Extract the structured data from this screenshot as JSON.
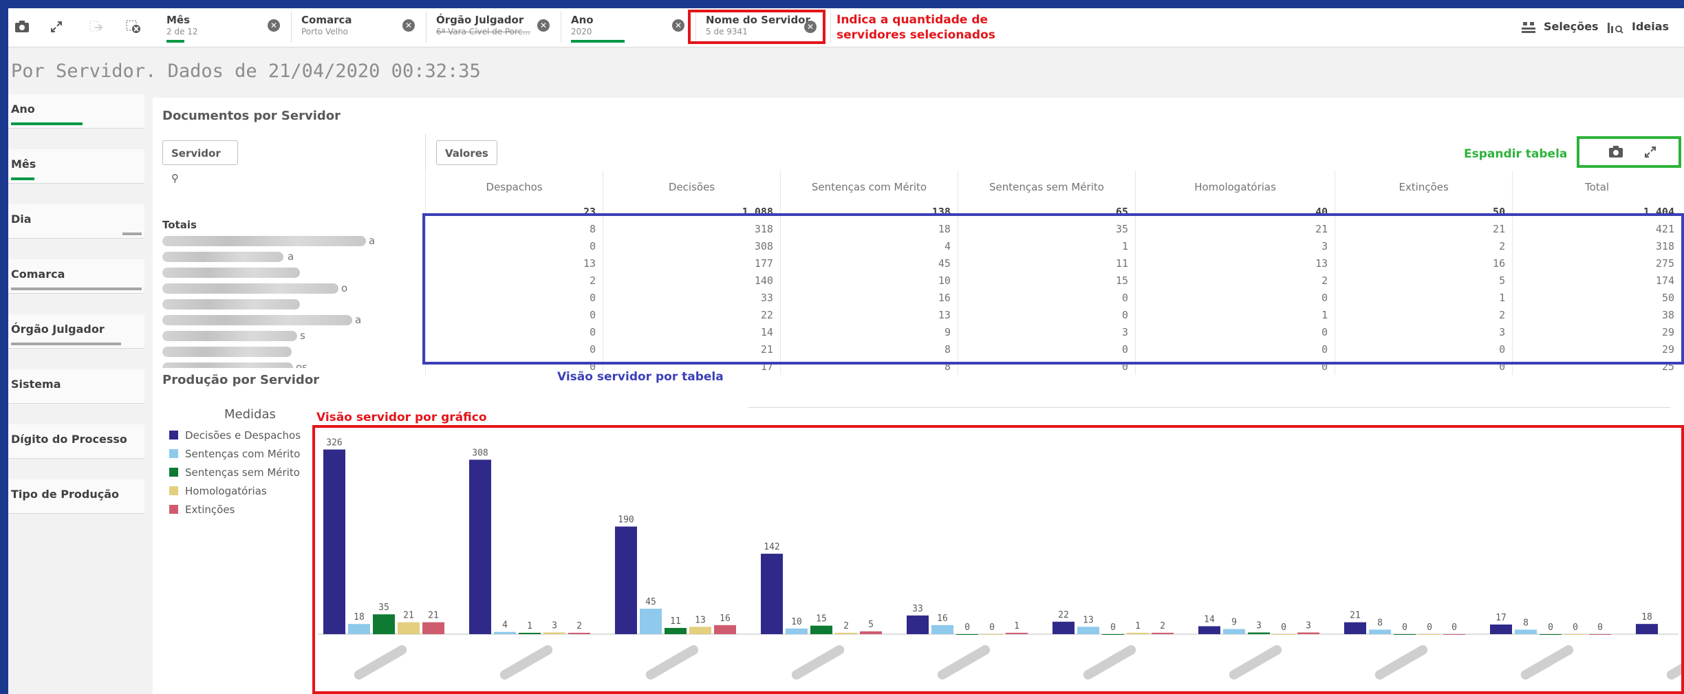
{
  "topbar": {
    "chips": [
      {
        "title": "Mês",
        "sub": "2 de 12"
      },
      {
        "title": "Comarca",
        "sub": "Porto Velho"
      },
      {
        "title": "Órgão Julgador",
        "sub": "6ª Vara Cível de Porc..."
      },
      {
        "title": "Ano",
        "sub": "2020"
      },
      {
        "title": "Nome do Servidor",
        "sub": "5 de 9341"
      }
    ],
    "selections_label": "Seleções",
    "ideas_label": "Ideias"
  },
  "annotations": {
    "servers_line1": "Indica a quantidade de",
    "servers_line2": "servidores selecionados",
    "expand_table": "Espandir tabela",
    "table_view": "Visão servidor por tabela",
    "chart_view": "Visão servidor por gráfico"
  },
  "page_title": "Por Servidor. Dados de 21/04/2020 00:32:35",
  "filters": [
    "Ano",
    "Mês",
    "Dia",
    "Comarca",
    "Órgão Julgador",
    "Sistema",
    "Dígito do Processo",
    "Tipo de Produção"
  ],
  "table": {
    "title": "Documentos por Servidor",
    "search_label": "Servidor",
    "values_label": "Valores",
    "columns": [
      "Despachos",
      "Decisões",
      "Sentenças com Mérito",
      "Sentenças sem Mérito",
      "Homologatórias",
      "Extinções",
      "Total"
    ],
    "totals_label": "Totais",
    "name_suffixes": [
      "a",
      "a",
      "",
      "o",
      "",
      "a",
      "s",
      "",
      "os"
    ],
    "rows": [
      [
        "23",
        "1.088",
        "138",
        "65",
        "40",
        "50",
        "1.404"
      ],
      [
        "8",
        "318",
        "18",
        "35",
        "21",
        "21",
        "421"
      ],
      [
        "0",
        "308",
        "4",
        "1",
        "3",
        "2",
        "318"
      ],
      [
        "13",
        "177",
        "45",
        "11",
        "13",
        "16",
        "275"
      ],
      [
        "2",
        "140",
        "10",
        "15",
        "2",
        "5",
        "174"
      ],
      [
        "0",
        "33",
        "16",
        "0",
        "0",
        "1",
        "50"
      ],
      [
        "0",
        "22",
        "13",
        "0",
        "1",
        "2",
        "38"
      ],
      [
        "0",
        "14",
        "9",
        "3",
        "0",
        "3",
        "29"
      ],
      [
        "0",
        "21",
        "8",
        "0",
        "0",
        "0",
        "29"
      ],
      [
        "0",
        "17",
        "8",
        "0",
        "0",
        "0",
        "25"
      ]
    ]
  },
  "chart": {
    "title": "Produção por Servidor",
    "legend_title": "Medidas"
  },
  "chart_data": {
    "type": "bar",
    "title": "Produção por Servidor",
    "categories": [
      "",
      "",
      "",
      "",
      "",
      "",
      "",
      "",
      "",
      ""
    ],
    "series": [
      {
        "name": "Decisões e Despachos",
        "color": "#2f2a8a",
        "values": [
          326,
          308,
          190,
          142,
          33,
          22,
          14,
          21,
          17,
          18
        ]
      },
      {
        "name": "Sentenças com Mérito",
        "color": "#8fc9ec",
        "values": [
          18,
          4,
          45,
          10,
          16,
          13,
          9,
          8,
          8,
          null
        ]
      },
      {
        "name": "Sentenças sem Mérito",
        "color": "#0e7a32",
        "values": [
          35,
          1,
          11,
          15,
          0,
          0,
          3,
          0,
          0,
          null
        ]
      },
      {
        "name": "Homologatórias",
        "color": "#e3cf7d",
        "values": [
          21,
          3,
          13,
          2,
          0,
          1,
          0,
          0,
          0,
          null
        ]
      },
      {
        "name": "Extinções",
        "color": "#cf5c6e",
        "values": [
          21,
          2,
          16,
          5,
          1,
          2,
          3,
          0,
          0,
          null
        ]
      }
    ],
    "ylim": [
      0,
      340
    ],
    "legend_position": "left"
  }
}
